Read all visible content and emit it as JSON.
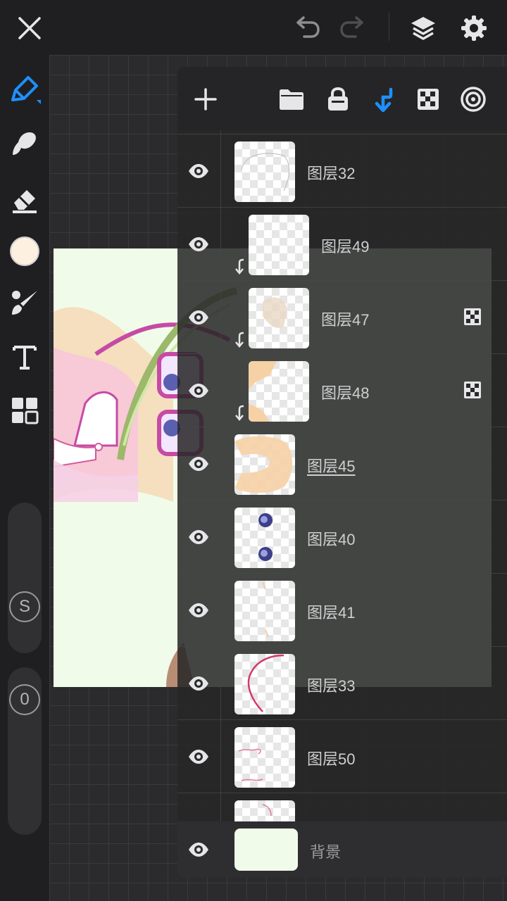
{
  "topbar": {
    "icons": [
      "close-icon",
      "undo-icon",
      "redo-icon",
      "layers-icon",
      "settings-icon"
    ]
  },
  "colors": {
    "accent": "#1e90ff",
    "current_color": "#fdf0e1",
    "background_layer": "#f1fbe9"
  },
  "leftbar": {
    "tools": [
      "brush-icon",
      "smudge-icon",
      "eraser-icon",
      "color-swatch",
      "blend-brush-icon",
      "text-icon",
      "materials-icon"
    ],
    "size_slider_label": "S",
    "opacity_slider_label": "0"
  },
  "layers_panel": {
    "header_icons": [
      "add-layer-icon",
      "folder-icon",
      "lock-icon",
      "clipping-icon",
      "alpha-lock-icon",
      "blend-mode-icon"
    ],
    "layers": [
      {
        "name": "图层32",
        "clipped": false,
        "alpha_lock": false,
        "selected": false
      },
      {
        "name": "图层49",
        "clipped": true,
        "alpha_lock": false,
        "selected": false
      },
      {
        "name": "图层47",
        "clipped": true,
        "alpha_lock": true,
        "selected": false
      },
      {
        "name": "图层48",
        "clipped": true,
        "alpha_lock": true,
        "selected": false
      },
      {
        "name": "图层45",
        "clipped": false,
        "alpha_lock": false,
        "selected": true
      },
      {
        "name": "图层40",
        "clipped": false,
        "alpha_lock": false,
        "selected": false
      },
      {
        "name": "图层41",
        "clipped": false,
        "alpha_lock": false,
        "selected": false
      },
      {
        "name": "图层33",
        "clipped": false,
        "alpha_lock": false,
        "selected": false
      },
      {
        "name": "图层50",
        "clipped": false,
        "alpha_lock": false,
        "selected": false
      }
    ],
    "background_layer_name": "背景"
  }
}
